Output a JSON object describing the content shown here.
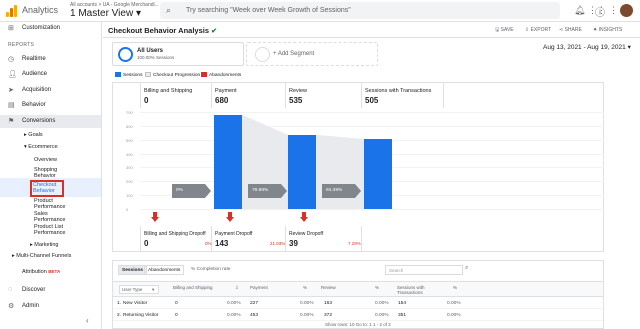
{
  "topbar": {
    "app_title": "Analytics",
    "account_path": "All accounts > UA - Google Merchandi...",
    "view_name": "1 Master View",
    "search_placeholder": "Try searching \"Week over Week Growth of Sessions\"",
    "logo_colors": [
      "#f9ab00",
      "#e37400",
      "#f9ab00"
    ]
  },
  "sidebar": {
    "customization": "Customization",
    "reports_header": "REPORTS",
    "items": [
      {
        "label": "Realtime",
        "icon": "clock-icon"
      },
      {
        "label": "Audience",
        "icon": "person-icon"
      },
      {
        "label": "Acquisition",
        "icon": "acquisition-icon"
      },
      {
        "label": "Behavior",
        "icon": "behavior-icon"
      },
      {
        "label": "Conversions",
        "icon": "flag-icon"
      }
    ],
    "goals": "Goals",
    "ecommerce": "Ecommerce",
    "ecommerce_items": [
      "Overview",
      "Shopping Behavior"
    ],
    "checkout_behavior_line1": "Checkout",
    "checkout_behavior_line2": "Behavior",
    "product_performance": "Product Performance",
    "sales_performance": "Sales Performance",
    "product_list": "Product List Performance",
    "marketing": "Marketing",
    "multi_channel": "Multi-Channel Funnels",
    "attribution": "Attribution",
    "beta": "BETA",
    "discover": "Discover",
    "admin": "Admin"
  },
  "report": {
    "title": "Checkout Behavior Analysis",
    "actions": [
      "SAVE",
      "EXPORT",
      "SHARE",
      "INSIGHTS"
    ],
    "segment_name": "All Users",
    "segment_sub": "100.00% Sessions",
    "add_segment": "+ Add Segment",
    "date_range": "Aug 13, 2021 - Aug 19, 2021"
  },
  "legend": [
    {
      "label": "Sessions",
      "color": "#1a73e8"
    },
    {
      "label": "Checkout Progression",
      "color": "#e8eaed"
    },
    {
      "label": "Abandonments",
      "color": "#d93025"
    }
  ],
  "chart_data": {
    "type": "bar",
    "categories": [
      "Billing and Shipping",
      "Payment",
      "Review",
      "Sessions with Transactions"
    ],
    "values": [
      0,
      680,
      535,
      505
    ],
    "yticks": [
      "700",
      "600",
      "500",
      "400",
      "300",
      "200",
      "100",
      "0"
    ],
    "ylim": [
      0,
      700
    ],
    "progression": [
      "0%",
      "78.68%",
      "94.39%"
    ],
    "dropoffs": [
      {
        "label": "Billing and Shipping Dropoff",
        "value": "0",
        "pct": "0%"
      },
      {
        "label": "Payment Dropoff",
        "value": "143",
        "pct": "21.03%"
      },
      {
        "label": "Review Dropoff",
        "value": "39",
        "pct": "7.29%"
      }
    ]
  },
  "table": {
    "tabs": [
      "Sessions",
      "Abandonments"
    ],
    "completion_rate": "% Completion rate",
    "search_placeholder": "Search",
    "sort_label": "User Type",
    "headers": [
      "User Type",
      "Billing and Shipping",
      "%",
      "Payment",
      "%",
      "Review",
      "%",
      "Sessions with Transactions",
      "%"
    ],
    "rows": [
      {
        "idx": "1.",
        "type": "New Visitor",
        "billing": "0",
        "billing_pct": "0.00%",
        "payment": "227",
        "payment_pct": "0.00%",
        "review": "163",
        "review_pct": "0.00%",
        "trans": "154",
        "trans_pct": "0.00%"
      },
      {
        "idx": "2.",
        "type": "Returning Visitor",
        "billing": "0",
        "billing_pct": "0.00%",
        "payment": "453",
        "payment_pct": "0.00%",
        "review": "372",
        "review_pct": "0.00%",
        "trans": "351",
        "trans_pct": "0.00%"
      }
    ],
    "pager": "Show rows: 10   Go to: 1   1 - 2 of 2"
  }
}
